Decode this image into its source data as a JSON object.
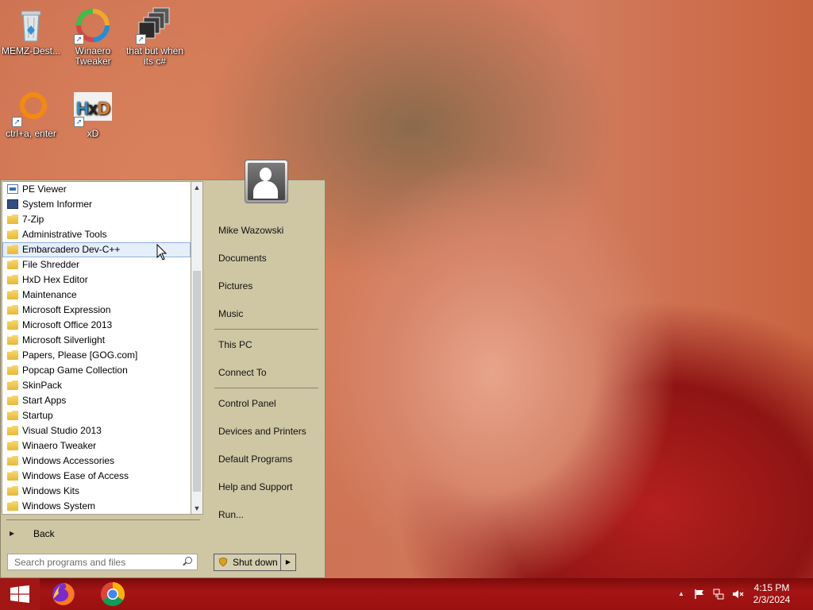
{
  "desktop": {
    "icons": [
      {
        "label": "MEMZ-Dest...",
        "icon": "recycle-bin-icon"
      },
      {
        "label": "Winaero Tweaker",
        "icon": "winaero-icon"
      },
      {
        "label": "that but when its c#",
        "icon": "stacked-windows-icon"
      },
      {
        "label": "ctrl+a, enter",
        "icon": "orange-ring-icon"
      },
      {
        "label": "xD",
        "icon": "hxd-icon"
      }
    ]
  },
  "start_menu": {
    "programs": [
      {
        "label": "PE Viewer",
        "icon": "window-icon"
      },
      {
        "label": "System Informer",
        "icon": "monitor-icon"
      },
      {
        "label": "7-Zip",
        "icon": "folder-icon"
      },
      {
        "label": "Administrative Tools",
        "icon": "folder-icon"
      },
      {
        "label": "Embarcadero Dev-C++",
        "icon": "folder-icon",
        "selected": true
      },
      {
        "label": "File Shredder",
        "icon": "folder-icon"
      },
      {
        "label": "HxD Hex Editor",
        "icon": "folder-icon"
      },
      {
        "label": "Maintenance",
        "icon": "folder-icon"
      },
      {
        "label": "Microsoft Expression",
        "icon": "folder-icon"
      },
      {
        "label": "Microsoft Office 2013",
        "icon": "folder-icon"
      },
      {
        "label": "Microsoft Silverlight",
        "icon": "folder-icon"
      },
      {
        "label": "Papers, Please [GOG.com]",
        "icon": "folder-icon"
      },
      {
        "label": "Popcap Game Collection",
        "icon": "folder-icon"
      },
      {
        "label": "SkinPack",
        "icon": "folder-icon"
      },
      {
        "label": "Start Apps",
        "icon": "folder-icon"
      },
      {
        "label": "Startup",
        "icon": "folder-icon"
      },
      {
        "label": "Visual Studio 2013",
        "icon": "folder-icon"
      },
      {
        "label": "Winaero Tweaker",
        "icon": "folder-icon"
      },
      {
        "label": "Windows Accessories",
        "icon": "folder-icon"
      },
      {
        "label": "Windows Ease of Access",
        "icon": "folder-icon"
      },
      {
        "label": "Windows Kits",
        "icon": "folder-icon"
      },
      {
        "label": "Windows System",
        "icon": "folder-icon"
      }
    ],
    "back_label": "Back",
    "search_placeholder": "Search programs and files",
    "user_name": "Mike Wazowski",
    "right_links_group1": [
      "Documents",
      "Pictures",
      "Music"
    ],
    "right_links_group2": [
      "This PC",
      "Connect To"
    ],
    "right_links_group3": [
      "Control Panel",
      "Devices and Printers",
      "Default Programs",
      "Help and Support",
      "Run..."
    ],
    "shutdown_label": "Shut down"
  },
  "taskbar": {
    "apps": [
      "firefox-icon",
      "chrome-icon"
    ],
    "clock_time": "4:15 PM",
    "clock_date": "2/3/2024"
  }
}
